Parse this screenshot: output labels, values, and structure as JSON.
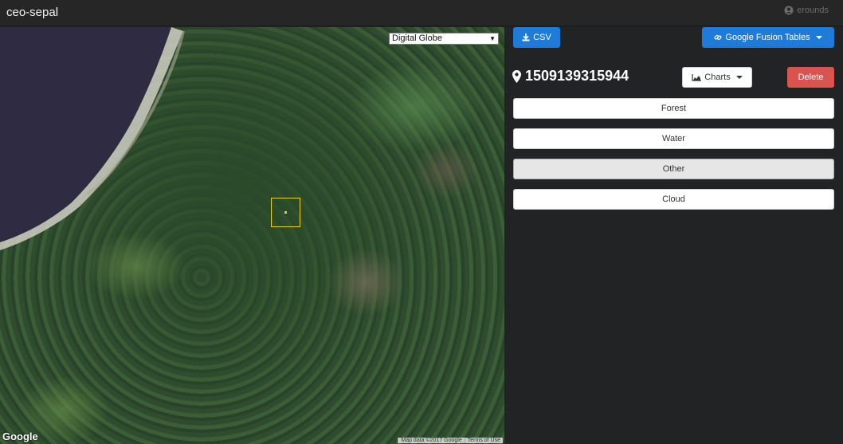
{
  "app": {
    "title": "ceo-sepal",
    "user": "erounds"
  },
  "map": {
    "imagery_select": "Digital Globe",
    "google_logo": "Google",
    "attribution": [
      "Map data ©2017 Google",
      "Terms of Use"
    ]
  },
  "toolbar": {
    "csv_label": "CSV",
    "fusion_label": "Google Fusion Tables"
  },
  "plot": {
    "id": "1509139315944",
    "charts_label": "Charts",
    "delete_label": "Delete"
  },
  "classes": [
    {
      "label": "Forest",
      "selected": false
    },
    {
      "label": "Water",
      "selected": false
    },
    {
      "label": "Other",
      "selected": true
    },
    {
      "label": "Cloud",
      "selected": false
    }
  ],
  "colors": {
    "primary": "#1f7bd8",
    "danger": "#d9534f",
    "plot_outline": "#e9d51a",
    "background": "#222324"
  },
  "icons": {
    "user": "user-circle-icon",
    "csv": "download-icon",
    "fusion": "link-icon",
    "plot": "map-marker-icon",
    "charts": "area-chart-icon"
  }
}
